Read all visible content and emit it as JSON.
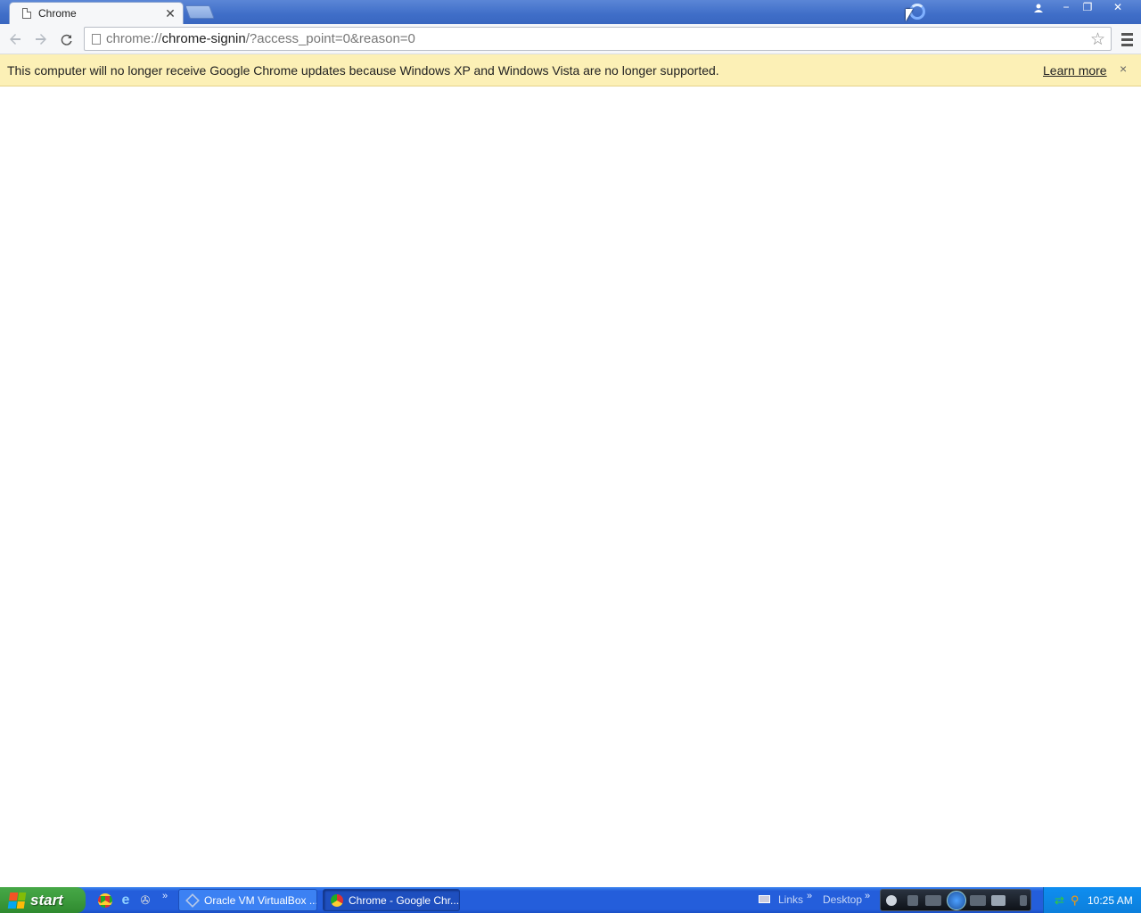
{
  "browser": {
    "tab_title": "Chrome",
    "tab_close": "✕",
    "url_scheme": "chrome://",
    "url_host": "chrome-signin",
    "url_rest": "/?access_point=0&reason=0",
    "star_icon": "star-icon",
    "window_buttons": {
      "minimize": "−",
      "maximize": "❐",
      "close": "✕"
    }
  },
  "infobar": {
    "message": "This computer will no longer receive Google Chrome updates because Windows XP and Windows Vista are no longer supported.",
    "learn_more": "Learn more",
    "close": "×"
  },
  "taskbar": {
    "start_label": "start",
    "tasks": [
      {
        "label": "Oracle VM VirtualBox ..."
      },
      {
        "label": "Chrome - Google Chr..."
      }
    ],
    "links_label": "Links",
    "desktop_label": "Desktop",
    "chevron": "»",
    "clock": "10:25 AM"
  },
  "colors": {
    "titlebar": "#3f6ec8",
    "infobar": "#fcf0b6",
    "taskbar": "#245edb",
    "start_button": "#3c9a3c"
  }
}
